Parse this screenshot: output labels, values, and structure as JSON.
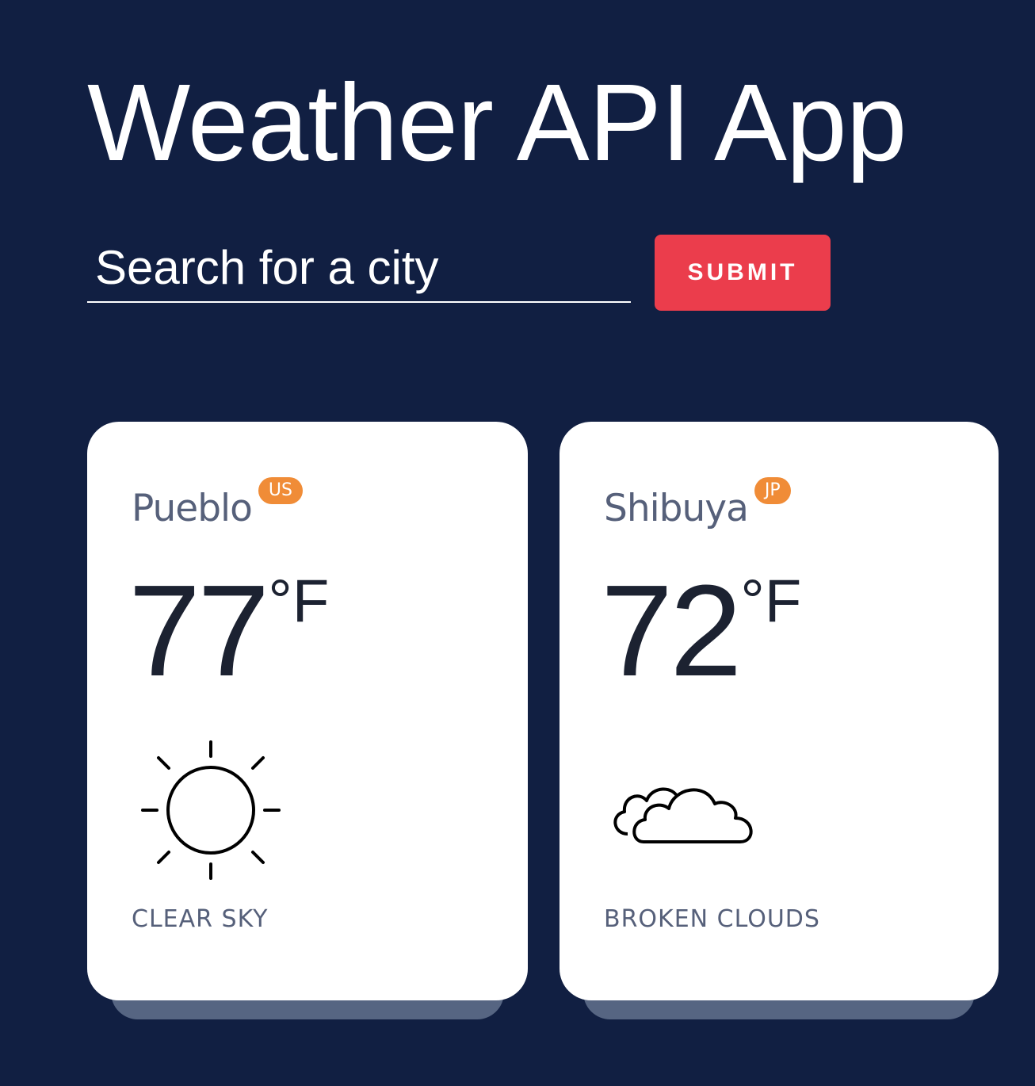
{
  "app": {
    "title": "Weather API App"
  },
  "search": {
    "placeholder": "Search for a city",
    "value": "",
    "submit_label": "SUBMIT"
  },
  "colors": {
    "background": "#111f42",
    "submit_button": "#eb3d4c",
    "country_badge": "#f08c37",
    "card": "#ffffff",
    "card_shadow": "#566582",
    "muted_text": "#56607a",
    "temperature_text": "#1c2231"
  },
  "cities": [
    {
      "name": "Pueblo",
      "country": "US",
      "temperature": "77",
      "unit": "°F",
      "icon": "clear-sky-sun-icon",
      "description": "CLEAR SKY"
    },
    {
      "name": "Shibuya",
      "country": "JP",
      "temperature": "72",
      "unit": "°F",
      "icon": "broken-clouds-icon",
      "description": "BROKEN CLOUDS"
    }
  ]
}
